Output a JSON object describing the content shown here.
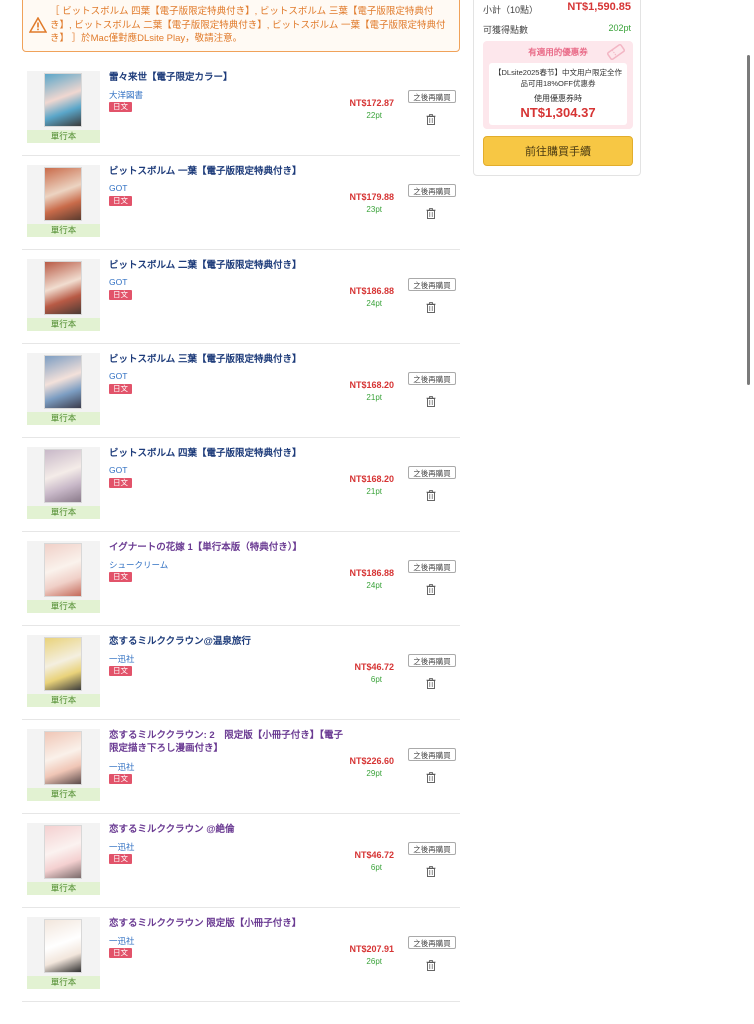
{
  "notice": {
    "text": "［ ビットスボルム 四葉【電子版限定特典付き】, ビットスボルム 三葉【電子版限定特典付き】, ビットスボルム 二葉【電子版限定特典付き】, ビットスボルム 一葉【電子版限定特典付き】 ］於Mac僅對應DLsite Play，敬請注意。"
  },
  "summary": {
    "subtotal_label": "小計（10點）",
    "subtotal_value": "NT$1,590.85",
    "points_label": "可獲得點數",
    "points_value": "202pt",
    "coupon_heading": "有適用的優惠券",
    "coupon_desc": "【DLsite2025春节】中文用户限定全作品可用18%OFF优惠券",
    "coupon_use_label": "使用優惠券時",
    "coupon_price": "NT$1,304.37",
    "checkout_label": "前往購買手續"
  },
  "item_labels": {
    "format": "單行本",
    "lang": "日文",
    "later": "之後再購買"
  },
  "items": [
    {
      "title": "雷々来世【電子限定カラー】",
      "circle": "大洋図書",
      "price": "NT$172.87",
      "points": "22pt",
      "title_color": "navy"
    },
    {
      "title": "ビットスボルム 一葉【電子版限定特典付き】",
      "circle": "GOT",
      "price": "NT$179.88",
      "points": "23pt",
      "title_color": "navy"
    },
    {
      "title": "ビットスボルム 二葉【電子版限定特典付き】",
      "circle": "GOT",
      "price": "NT$186.88",
      "points": "24pt",
      "title_color": "navy"
    },
    {
      "title": "ビットスボルム 三葉【電子版限定特典付き】",
      "circle": "GOT",
      "price": "NT$168.20",
      "points": "21pt",
      "title_color": "navy"
    },
    {
      "title": "ビットスボルム 四葉【電子版限定特典付き】",
      "circle": "GOT",
      "price": "NT$168.20",
      "points": "21pt",
      "title_color": "navy"
    },
    {
      "title": "イグナートの花嫁 1【単行本版（特典付き）】",
      "circle": "シュークリーム",
      "price": "NT$186.88",
      "points": "24pt",
      "title_color": "purple"
    },
    {
      "title": "恋するミルククラウン@温泉旅行",
      "circle": "一迅社",
      "price": "NT$46.72",
      "points": "6pt",
      "title_color": "navy"
    },
    {
      "title": "恋するミルククラウン: 2　限定版【小冊子付き】【電子限定描き下ろし漫画付き】",
      "circle": "一迅社",
      "price": "NT$226.60",
      "points": "29pt",
      "title_color": "purple"
    },
    {
      "title": "恋するミルククラウン @絶倫",
      "circle": "一迅社",
      "price": "NT$46.72",
      "points": "6pt",
      "title_color": "purple"
    },
    {
      "title": "恋するミルククラウン 限定版【小冊子付き】",
      "circle": "一迅社",
      "price": "NT$207.91",
      "points": "26pt",
      "title_color": "purple"
    }
  ],
  "colors": {
    "accent_orange": "#f0a25a",
    "price_red": "#d63434",
    "point_green": "#3aa33a",
    "checkout_yellow": "#f7c744",
    "lang_badge": "#e2536a"
  }
}
